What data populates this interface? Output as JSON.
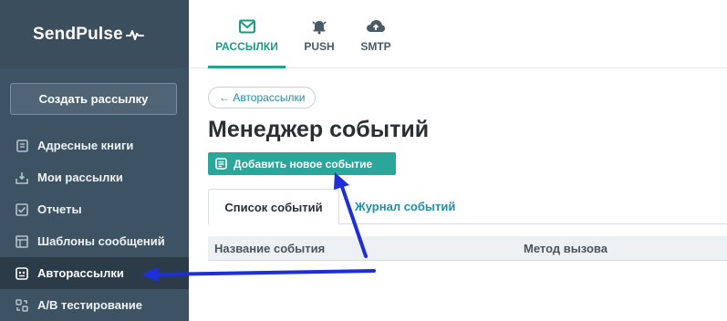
{
  "app": {
    "logo_text": "SendPulse"
  },
  "sidebar": {
    "create_label": "Создать рассылку",
    "items": [
      {
        "label": "Адресные книги",
        "icon": "address-book-icon"
      },
      {
        "label": "Мои рассылки",
        "icon": "inbox-icon"
      },
      {
        "label": "Отчеты",
        "icon": "chart-check-icon"
      },
      {
        "label": "Шаблоны сообщений",
        "icon": "template-icon"
      },
      {
        "label": "Авторассылки",
        "icon": "autoresponder-icon",
        "active": true
      },
      {
        "label": "A/B тестирование",
        "icon": "ab-test-icon"
      }
    ]
  },
  "topnav": {
    "tabs": [
      {
        "label": "РАССЫЛКИ",
        "icon": "mail-icon",
        "active": true
      },
      {
        "label": "PUSH",
        "icon": "bell-icon"
      },
      {
        "label": "SMTP",
        "icon": "cloud-upload-icon"
      }
    ]
  },
  "main": {
    "back_label": "← Авторассылки",
    "title": "Менеджер событий",
    "add_event_label": "Добавить новое событие",
    "subtabs": [
      {
        "label": "Список событий",
        "active": true
      },
      {
        "label": "Журнал событий"
      }
    ],
    "table": {
      "columns": [
        "Название события",
        "Метод вызова"
      ]
    }
  },
  "colors": {
    "sidebar_bg": "#3d5263",
    "sidebar_active_bg": "#2b3b47",
    "accent_green": "#21a38b",
    "button_teal": "#2aa69a",
    "link_blue": "#1f8fa6",
    "annotation_arrow": "#1f2fd8"
  }
}
